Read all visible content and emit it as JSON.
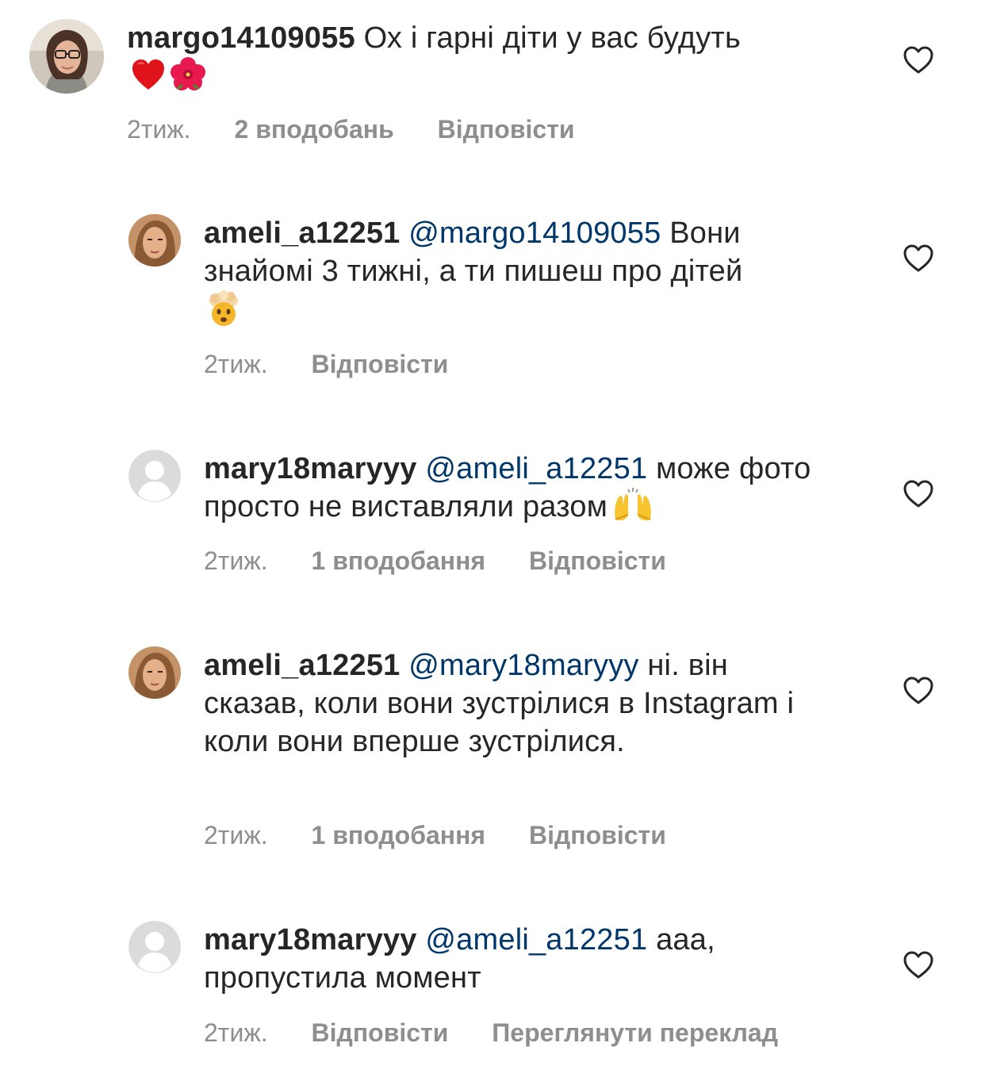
{
  "comments": [
    {
      "username": "margo14109055",
      "mention": "",
      "text": "Ох і гарні діти у вас будуть",
      "emojis": [
        "red-heart-emoji",
        "hibiscus-emoji"
      ],
      "time": "2тиж.",
      "likes": "2 вподобань",
      "reply": "Відповісти",
      "extra": ""
    },
    {
      "username": "ameli_a12251",
      "mention": "@margo14109055",
      "text": "Вони знайомі 3 тижні, а ти пишеш про дітей",
      "emojis": [
        "exploding-head-emoji"
      ],
      "time": "2тиж.",
      "likes": "",
      "reply": "Відповісти",
      "extra": ""
    },
    {
      "username": "mary18maryyy",
      "mention": "@ameli_a12251",
      "text": "може фото просто не виставляли разом",
      "emojis": [
        "raising-hands-emoji"
      ],
      "time": "2тиж.",
      "likes": "1 вподобання",
      "reply": "Відповісти",
      "extra": ""
    },
    {
      "username": "ameli_a12251",
      "mention": "@mary18maryyy",
      "text": "ні. він сказав, коли вони зустрілися в Instagram і коли вони вперше зустрілися.",
      "emojis": [],
      "time": "2тиж.",
      "likes": "1 вподобання",
      "reply": "Відповісти",
      "extra": ""
    },
    {
      "username": "mary18maryyy",
      "mention": "@ameli_a12251",
      "text": "ааа, пропустила момент",
      "emojis": [],
      "time": "2тиж.",
      "likes": "",
      "reply": "Відповісти",
      "extra": "Переглянути переклад"
    }
  ],
  "colors": {
    "text": "#262626",
    "mention": "#00376b",
    "meta": "#8e8e8e"
  }
}
